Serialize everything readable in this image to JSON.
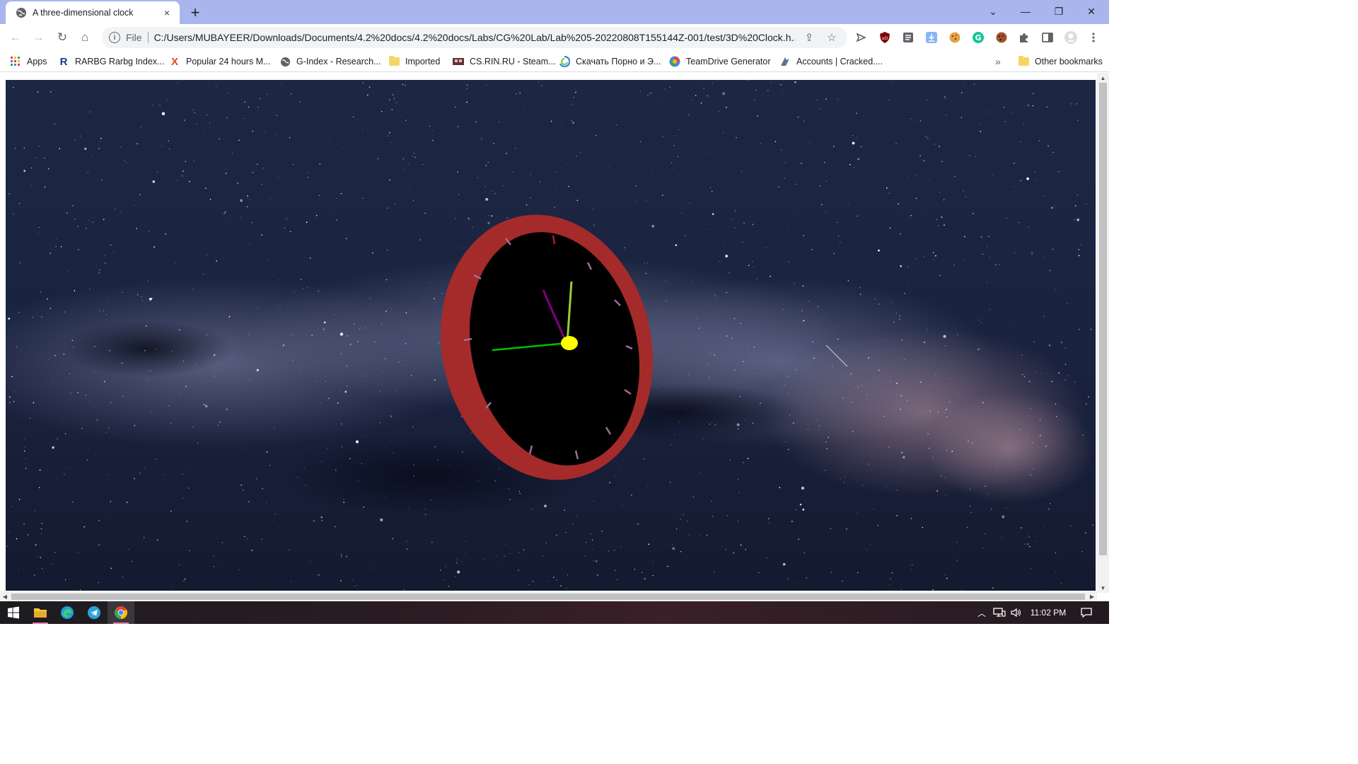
{
  "tab": {
    "title": "A three-dimensional clock",
    "favicon": "globe-icon",
    "close": "×"
  },
  "newtab": "+",
  "window_controls": {
    "tabsearch": "⌄",
    "minimize": "—",
    "restore": "❐",
    "close": "✕"
  },
  "toolbar": {
    "back": "←",
    "forward": "→",
    "reload": "↻",
    "home": "⌂",
    "scheme": "File",
    "url": "C:/Users/MUBAYEER/Downloads/Documents/4.2%20docs/4.2%20docs/Labs/CG%20Lab/Lab%205-20220808T155144Z-001/test/3D%20Clock.h...",
    "share": "⇪",
    "star": "☆"
  },
  "bookmarks": [
    {
      "label": "Apps",
      "icon": "apps-grid-icon"
    },
    {
      "label": "RARBG Rarbg Index...",
      "icon": "rarbg-icon"
    },
    {
      "label": "Popular 24 hours M...",
      "icon": "x-site-icon"
    },
    {
      "label": "G-Index - Research...",
      "icon": "globe-icon"
    },
    {
      "label": "Imported",
      "icon": "folder-icon"
    },
    {
      "label": "CS.RIN.RU - Steam...",
      "icon": "csrin-icon"
    },
    {
      "label": "Скачать Порно и Э...",
      "icon": "site-icon"
    },
    {
      "label": "TeamDrive Generator",
      "icon": "teamdrive-icon"
    },
    {
      "label": "Accounts | Cracked....",
      "icon": "cracked-icon"
    }
  ],
  "bookmarks_overflow": "»",
  "other_bookmarks": "Other bookmarks",
  "colors": {
    "clock_rim": "#a52a2a",
    "clock_face": "#000000",
    "hour_hand": "#800080",
    "minute_hand": "#9acd32",
    "second_hand": "#00c000",
    "hub": "#ffff00"
  },
  "taskbar": {
    "clock": "11:02 PM"
  }
}
